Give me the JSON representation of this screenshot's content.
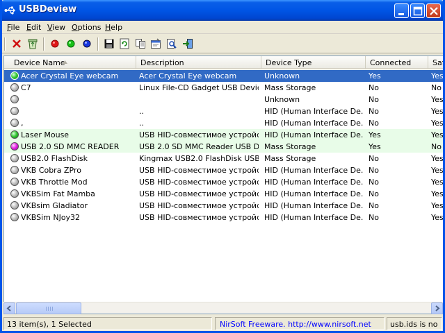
{
  "window": {
    "title": "USBDeview"
  },
  "menu": [
    {
      "label": "File",
      "u": "F",
      "rest": "ile"
    },
    {
      "label": "Edit",
      "u": "E",
      "rest": "dit"
    },
    {
      "label": "View",
      "u": "V",
      "rest": "iew"
    },
    {
      "label": "Options",
      "u": "O",
      "rest": "ptions"
    },
    {
      "label": "Help",
      "u": "H",
      "rest": "elp"
    }
  ],
  "toolbar": {
    "icons": [
      "uninstall-icon",
      "recycle-icon",
      "red-dot-icon",
      "green-dot-icon",
      "blue-dot-icon",
      "save-icon",
      "refresh-icon",
      "copy-icon",
      "properties-icon",
      "find-icon",
      "exit-icon"
    ]
  },
  "columns": [
    "Device Name",
    "Description",
    "Device Type",
    "Connected",
    "Safe"
  ],
  "rows": [
    {
      "name": "Acer Crystal Eye webcam",
      "desc": "Acer Crystal Eye webcam",
      "type": "Unknown",
      "connected": "Yes",
      "safe": "Yes",
      "dot": "greenhl",
      "style": "selected"
    },
    {
      "name": "C7",
      "desc": "Linux File-CD Gadget USB Device",
      "type": "Mass Storage",
      "connected": "No",
      "safe": "No",
      "dot": "gray",
      "style": ""
    },
    {
      "name": "",
      "desc": "",
      "type": "Unknown",
      "connected": "No",
      "safe": "Yes",
      "dot": "gray",
      "style": ""
    },
    {
      "name": "",
      "desc": "..",
      "type": "HID (Human Interface De...",
      "connected": "No",
      "safe": "Yes",
      "dot": "gray",
      "style": ""
    },
    {
      "name": ",",
      "desc": "..",
      "type": "HID (Human Interface De...",
      "connected": "No",
      "safe": "Yes",
      "dot": "gray",
      "style": ""
    },
    {
      "name": "Laser Mouse",
      "desc": "USB HID-совместимое устройс...",
      "type": "HID (Human Interface De...",
      "connected": "Yes",
      "safe": "Yes",
      "dot": "green",
      "style": "green"
    },
    {
      "name": "USB 2.0  SD MMC READER",
      "desc": "USB 2.0 SD MMC Reader USB De...",
      "type": "Mass Storage",
      "connected": "Yes",
      "safe": "No",
      "dot": "magenta",
      "style": "green"
    },
    {
      "name": "USB2.0 FlashDisk",
      "desc": "Kingmax USB2.0 FlashDisk USB ...",
      "type": "Mass Storage",
      "connected": "No",
      "safe": "Yes",
      "dot": "gray",
      "style": ""
    },
    {
      "name": "VKB Cobra ZPro",
      "desc": "USB HID-совместимое устройс...",
      "type": "HID (Human Interface De...",
      "connected": "No",
      "safe": "Yes",
      "dot": "gray",
      "style": ""
    },
    {
      "name": "VKB Throttle Mod",
      "desc": "USB HID-совместимое устройс...",
      "type": "HID (Human Interface De...",
      "connected": "No",
      "safe": "Yes",
      "dot": "gray",
      "style": ""
    },
    {
      "name": "VKBSim Fat Mamba",
      "desc": "USB HID-совместимое устройс...",
      "type": "HID (Human Interface De...",
      "connected": "No",
      "safe": "Yes",
      "dot": "gray",
      "style": ""
    },
    {
      "name": "VKBsim Gladiator",
      "desc": "USB HID-совместимое устройс...",
      "type": "HID (Human Interface De...",
      "connected": "No",
      "safe": "Yes",
      "dot": "gray",
      "style": ""
    },
    {
      "name": "VKBSim NJoy32",
      "desc": "USB HID-совместимое устройс...",
      "type": "HID (Human Interface De...",
      "connected": "No",
      "safe": "Yes",
      "dot": "gray",
      "style": ""
    }
  ],
  "status": {
    "count": "13 item(s), 1 Selected",
    "nirsoft": "NirSoft Freeware.  http://www.nirsoft.net",
    "usbids": "usb.ids is no"
  }
}
